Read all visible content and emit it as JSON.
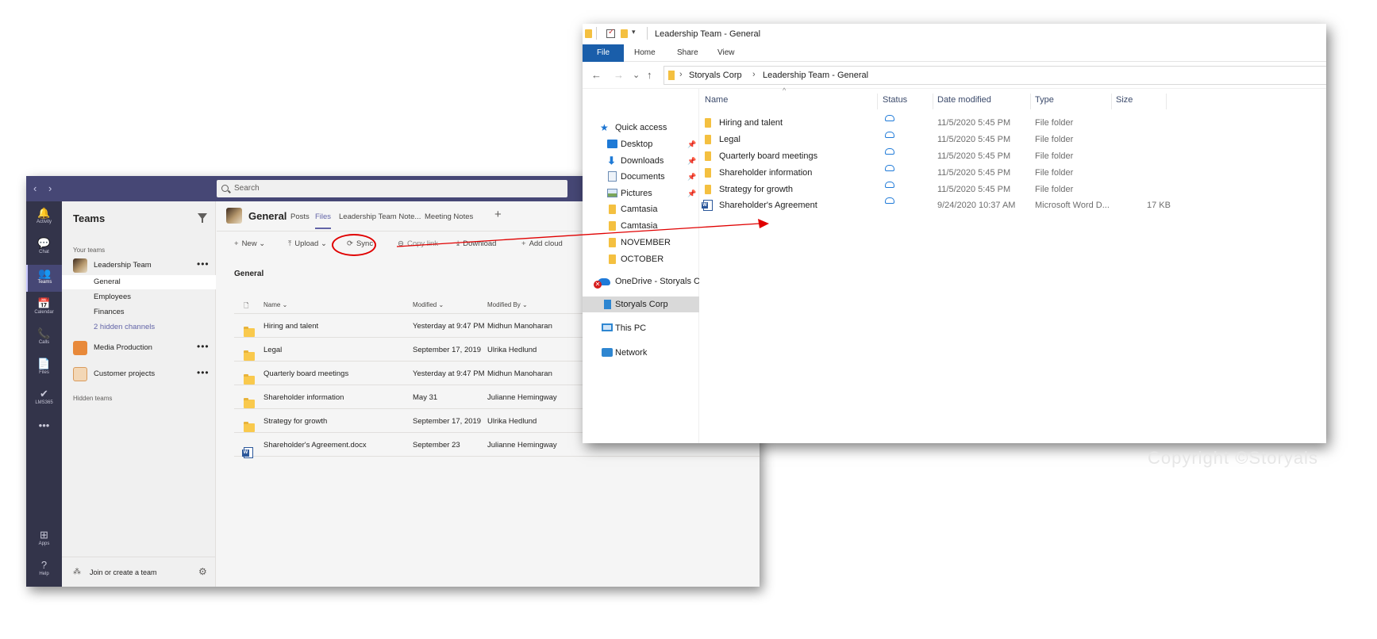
{
  "teams": {
    "nav_back": "‹",
    "nav_forward": "›",
    "search_placeholder": "Search",
    "rail": [
      {
        "label": "Activity",
        "icon": "🔔"
      },
      {
        "label": "Chat",
        "icon": "💬"
      },
      {
        "label": "Teams",
        "icon": "👥"
      },
      {
        "label": "Calendar",
        "icon": "📅"
      },
      {
        "label": "Calls",
        "icon": "📞"
      },
      {
        "label": "Files",
        "icon": "📄"
      },
      {
        "label": "LMS365",
        "icon": "✔"
      },
      {
        "label": "",
        "icon": "•••"
      },
      {
        "label": "Apps",
        "icon": "⊞"
      },
      {
        "label": "Help",
        "icon": "?"
      }
    ],
    "panel": {
      "title": "Teams",
      "your_teams": "Your teams",
      "teams": [
        {
          "name": "Leadership Team",
          "more": "•••"
        },
        {
          "name": "Media Production",
          "more": "•••"
        },
        {
          "name": "Customer projects",
          "more": "•••"
        }
      ],
      "channels": [
        "General",
        "Employees",
        "Finances",
        "2 hidden channels"
      ],
      "hidden_teams": "Hidden teams",
      "join": "Join or create a team"
    },
    "channel": {
      "name": "General",
      "tabs": [
        "Posts",
        "Files",
        "Leadership Team Note...",
        "Meeting Notes"
      ],
      "add_tab": "+"
    },
    "toolbar": [
      {
        "label": "New",
        "icon": "+",
        "caret": "⌄"
      },
      {
        "label": "Upload",
        "icon": "⤒",
        "caret": "⌄"
      },
      {
        "label": "Sync",
        "icon": "⟳"
      },
      {
        "label": "Copy link",
        "icon": "⊖"
      },
      {
        "label": "Download",
        "icon": "⤓"
      },
      {
        "label": "Add cloud",
        "icon": "+"
      }
    ],
    "folder_title": "General",
    "file_columns": [
      "Name ⌄",
      "Modified ⌄",
      "Modified By ⌄"
    ],
    "files": [
      {
        "name": "Hiring and talent",
        "modified": "Yesterday at 9:47 PM",
        "by": "Midhun Manoharan",
        "kind": "folder"
      },
      {
        "name": "Legal",
        "modified": "September 17, 2019",
        "by": "Ulrika Hedlund",
        "kind": "folder"
      },
      {
        "name": "Quarterly board meetings",
        "modified": "Yesterday at 9:47 PM",
        "by": "Midhun Manoharan",
        "kind": "folder"
      },
      {
        "name": "Shareholder information",
        "modified": "May 31",
        "by": "Julianne Hemingway",
        "kind": "folder"
      },
      {
        "name": "Strategy for growth",
        "modified": "September 17, 2019",
        "by": "Ulrika Hedlund",
        "kind": "folder"
      },
      {
        "name": "Shareholder's Agreement.docx",
        "modified": "September 23",
        "by": "Julianne Hemingway",
        "kind": "word"
      }
    ]
  },
  "explorer": {
    "title": "Leadership Team - General",
    "qat_dropdown": "▾",
    "ribbon_tabs": [
      "File",
      "Home",
      "Share",
      "View"
    ],
    "nav": {
      "back": "←",
      "forward": "→",
      "recent": "⌄",
      "up": "↑"
    },
    "breadcrumb": [
      "Storyals Corp",
      "Leadership Team - General"
    ],
    "breadcrumb_sep": "›",
    "sidebar": [
      {
        "label": "Quick access",
        "icon": "star"
      },
      {
        "label": "Desktop",
        "icon": "desktop",
        "pinned": true
      },
      {
        "label": "Downloads",
        "icon": "downloads",
        "pinned": true
      },
      {
        "label": "Documents",
        "icon": "documents",
        "pinned": true
      },
      {
        "label": "Pictures",
        "icon": "pictures",
        "pinned": true
      },
      {
        "label": "Camtasia",
        "icon": "folder"
      },
      {
        "label": "Camtasia",
        "icon": "folder"
      },
      {
        "label": "NOVEMBER",
        "icon": "folder"
      },
      {
        "label": "OCTOBER",
        "icon": "folder"
      },
      {
        "label": "OneDrive - Storyals C",
        "icon": "onedrive-error"
      },
      {
        "label": "Storyals Corp",
        "icon": "sharepoint",
        "selected": true
      },
      {
        "label": "This PC",
        "icon": "pc"
      },
      {
        "label": "Network",
        "icon": "network"
      }
    ],
    "pin_glyph": "📌",
    "columns": [
      "Name",
      "Status",
      "Date modified",
      "Type",
      "Size"
    ],
    "sort_caret": "^",
    "rows": [
      {
        "name": "Hiring and talent",
        "date": "11/5/2020 5:45 PM",
        "type": "File folder",
        "size": "",
        "kind": "folder"
      },
      {
        "name": "Legal",
        "date": "11/5/2020 5:45 PM",
        "type": "File folder",
        "size": "",
        "kind": "folder"
      },
      {
        "name": "Quarterly board meetings",
        "date": "11/5/2020 5:45 PM",
        "type": "File folder",
        "size": "",
        "kind": "folder"
      },
      {
        "name": "Shareholder information",
        "date": "11/5/2020 5:45 PM",
        "type": "File folder",
        "size": "",
        "kind": "folder"
      },
      {
        "name": "Strategy for growth",
        "date": "11/5/2020 5:45 PM",
        "type": "File folder",
        "size": "",
        "kind": "folder"
      },
      {
        "name": "Shareholder's Agreement",
        "date": "9/24/2020 10:37 AM",
        "type": "Microsoft Word D...",
        "size": "17 KB",
        "kind": "word"
      }
    ]
  },
  "annotation": {
    "highlight_color": "#e00000",
    "copyright": "Copyright ©Storyals"
  }
}
